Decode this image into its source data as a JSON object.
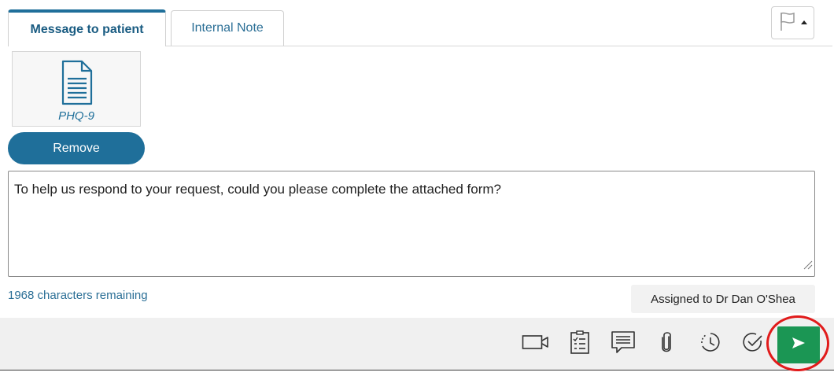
{
  "tabs": {
    "message_to_patient": "Message to patient",
    "internal_note": "Internal Note"
  },
  "flag": {
    "icon": "flag-icon"
  },
  "attachment": {
    "name": "PHQ-9",
    "icon": "document-icon"
  },
  "remove_label": "Remove",
  "message": {
    "text": "To help us respond to your request, could you please complete the attached form?"
  },
  "chars_remaining": "1968 characters remaining",
  "assigned": "Assigned to Dr Dan O'Shea",
  "toolbar": {
    "icons": [
      "video-icon",
      "questionnaire-icon",
      "message-template-icon",
      "paperclip-icon",
      "schedule-icon",
      "check-icon",
      "send-icon"
    ]
  },
  "colors": {
    "accent": "#1f6f9a",
    "send": "#1b9654",
    "highlight": "#e11b1b"
  }
}
